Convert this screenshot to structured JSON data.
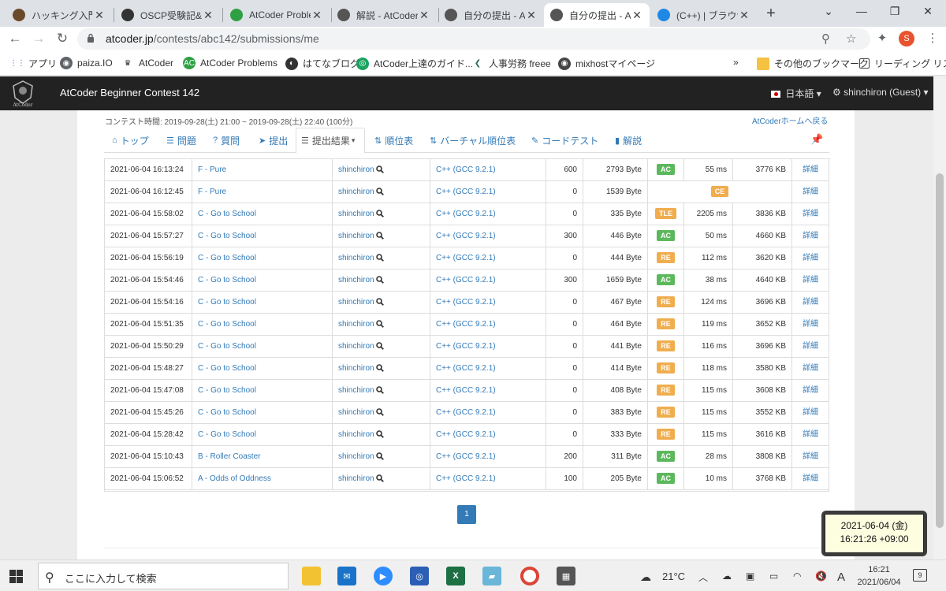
{
  "browser": {
    "tabs": [
      {
        "title": "ハッキング入門 Tr",
        "color": "#6b4a2a"
      },
      {
        "title": "OSCP受験記&",
        "color": "#333333"
      },
      {
        "title": "AtCoder Proble",
        "color": "#2ea043"
      },
      {
        "title": "解説 - AtCoder",
        "color": "#555555"
      },
      {
        "title": "自分の提出 - At",
        "color": "#555555"
      },
      {
        "title": "自分の提出 - A",
        "color": "#555555"
      },
      {
        "title": "(C++) | ブラウザ",
        "color": "#1e88e5"
      }
    ],
    "url_host": "atcoder.jp",
    "url_path": "/contests/abc142/submissions/me",
    "profile_initial": "S",
    "bookmarks": [
      {
        "label": "アプリ"
      },
      {
        "label": "paiza.IO"
      },
      {
        "label": "AtCoder"
      },
      {
        "label": "AtCoder Problems"
      },
      {
        "label": "はてなブログ"
      },
      {
        "label": "AtCoder上達のガイド..."
      },
      {
        "label": "人事労務 freee"
      },
      {
        "label": "mixhostマイページ"
      }
    ],
    "bookmarks_more": "»",
    "other_bookmarks": "その他のブックマーク",
    "reading_list": "リーディング リスト"
  },
  "site": {
    "logo_text": "AtCoder",
    "brand": "AtCoder Beginner Contest 142",
    "language": "日本語",
    "user": "shinchiron (Guest)",
    "contest_time": "コンテスト時間: 2019-09-28(土) 21:00 ~ 2019-09-28(土) 22:40 (100分)",
    "home_link": "AtCoderホームへ戻る",
    "nav": [
      {
        "label": "トップ"
      },
      {
        "label": "問題"
      },
      {
        "label": "質問"
      },
      {
        "label": "提出"
      },
      {
        "label": "提出結果"
      },
      {
        "label": "順位表"
      },
      {
        "label": "バーチャル順位表"
      },
      {
        "label": "コードテスト"
      },
      {
        "label": "解説"
      }
    ]
  },
  "submissions": [
    {
      "time": "2021-06-04 16:13:24",
      "task": "F - Pure",
      "user": "shinchiron",
      "lang": "C++ (GCC 9.2.1)",
      "score": "600",
      "size": "2793 Byte",
      "status": "AC",
      "exec": "55 ms",
      "mem": "3776 KB",
      "detail": "詳細"
    },
    {
      "time": "2021-06-04 16:12:45",
      "task": "F - Pure",
      "user": "shinchiron",
      "lang": "C++ (GCC 9.2.1)",
      "score": "0",
      "size": "1539 Byte",
      "status": "CE",
      "exec": "",
      "mem": "",
      "detail": "詳細"
    },
    {
      "time": "2021-06-04 15:58:02",
      "task": "C - Go to School",
      "user": "shinchiron",
      "lang": "C++ (GCC 9.2.1)",
      "score": "0",
      "size": "335 Byte",
      "status": "TLE",
      "exec": "2205 ms",
      "mem": "3836 KB",
      "detail": "詳細"
    },
    {
      "time": "2021-06-04 15:57:27",
      "task": "C - Go to School",
      "user": "shinchiron",
      "lang": "C++ (GCC 9.2.1)",
      "score": "300",
      "size": "446 Byte",
      "status": "AC",
      "exec": "50 ms",
      "mem": "4660 KB",
      "detail": "詳細"
    },
    {
      "time": "2021-06-04 15:56:19",
      "task": "C - Go to School",
      "user": "shinchiron",
      "lang": "C++ (GCC 9.2.1)",
      "score": "0",
      "size": "444 Byte",
      "status": "RE",
      "exec": "112 ms",
      "mem": "3620 KB",
      "detail": "詳細"
    },
    {
      "time": "2021-06-04 15:54:46",
      "task": "C - Go to School",
      "user": "shinchiron",
      "lang": "C++ (GCC 9.2.1)",
      "score": "300",
      "size": "1659 Byte",
      "status": "AC",
      "exec": "38 ms",
      "mem": "4640 KB",
      "detail": "詳細"
    },
    {
      "time": "2021-06-04 15:54:16",
      "task": "C - Go to School",
      "user": "shinchiron",
      "lang": "C++ (GCC 9.2.1)",
      "score": "0",
      "size": "467 Byte",
      "status": "RE",
      "exec": "124 ms",
      "mem": "3696 KB",
      "detail": "詳細"
    },
    {
      "time": "2021-06-04 15:51:35",
      "task": "C - Go to School",
      "user": "shinchiron",
      "lang": "C++ (GCC 9.2.1)",
      "score": "0",
      "size": "464 Byte",
      "status": "RE",
      "exec": "119 ms",
      "mem": "3652 KB",
      "detail": "詳細"
    },
    {
      "time": "2021-06-04 15:50:29",
      "task": "C - Go to School",
      "user": "shinchiron",
      "lang": "C++ (GCC 9.2.1)",
      "score": "0",
      "size": "441 Byte",
      "status": "RE",
      "exec": "116 ms",
      "mem": "3696 KB",
      "detail": "詳細"
    },
    {
      "time": "2021-06-04 15:48:27",
      "task": "C - Go to School",
      "user": "shinchiron",
      "lang": "C++ (GCC 9.2.1)",
      "score": "0",
      "size": "414 Byte",
      "status": "RE",
      "exec": "118 ms",
      "mem": "3580 KB",
      "detail": "詳細"
    },
    {
      "time": "2021-06-04 15:47:08",
      "task": "C - Go to School",
      "user": "shinchiron",
      "lang": "C++ (GCC 9.2.1)",
      "score": "0",
      "size": "408 Byte",
      "status": "RE",
      "exec": "115 ms",
      "mem": "3608 KB",
      "detail": "詳細"
    },
    {
      "time": "2021-06-04 15:45:26",
      "task": "C - Go to School",
      "user": "shinchiron",
      "lang": "C++ (GCC 9.2.1)",
      "score": "0",
      "size": "383 Byte",
      "status": "RE",
      "exec": "115 ms",
      "mem": "3552 KB",
      "detail": "詳細"
    },
    {
      "time": "2021-06-04 15:28:42",
      "task": "C - Go to School",
      "user": "shinchiron",
      "lang": "C++ (GCC 9.2.1)",
      "score": "0",
      "size": "333 Byte",
      "status": "RE",
      "exec": "115 ms",
      "mem": "3616 KB",
      "detail": "詳細"
    },
    {
      "time": "2021-06-04 15:10:43",
      "task": "B - Roller Coaster",
      "user": "shinchiron",
      "lang": "C++ (GCC 9.2.1)",
      "score": "200",
      "size": "311 Byte",
      "status": "AC",
      "exec": "28 ms",
      "mem": "3808 KB",
      "detail": "詳細"
    },
    {
      "time": "2021-06-04 15:06:52",
      "task": "A - Odds of Oddness",
      "user": "shinchiron",
      "lang": "C++ (GCC 9.2.1)",
      "score": "100",
      "size": "205 Byte",
      "status": "AC",
      "exec": "10 ms",
      "mem": "3768 KB",
      "detail": "詳細"
    }
  ],
  "pagination": {
    "current": "1"
  },
  "clock_widget": {
    "line1": "2021-06-04 (金)",
    "line2": "16:21:26 +09:00"
  },
  "taskbar": {
    "search_placeholder": "ここに入力して検索",
    "weather": "21°C",
    "ime": "A",
    "time": "16:21",
    "date": "2021/06/04",
    "notifications": "9"
  },
  "colors": {
    "ac": "#5cb85c",
    "warn": "#f0ad4e",
    "link": "#337ab7",
    "navbar": "#222222"
  }
}
